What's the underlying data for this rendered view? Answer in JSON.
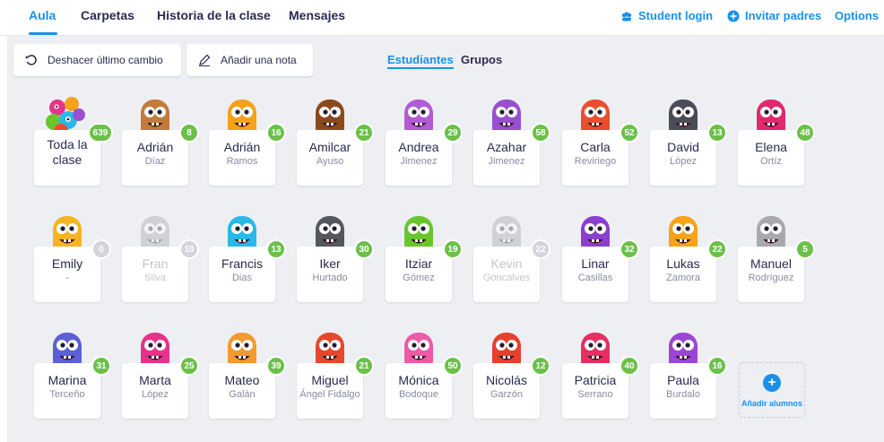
{
  "nav": {
    "tabs": [
      {
        "label": "Aula",
        "active": true
      },
      {
        "label": "Carpetas",
        "active": false
      },
      {
        "label": "Historia de la clase",
        "active": false
      },
      {
        "label": "Mensajes",
        "active": false
      }
    ],
    "student_login": "Student login",
    "invite_parents": "Invitar padres",
    "options": "Options"
  },
  "toolbar": {
    "undo_label": "Deshacer último cambio",
    "note_label": "Añadir una nota",
    "view_students": "Estudiantes",
    "view_groups": "Grupos"
  },
  "whole_class": {
    "label": "Toda la clase",
    "points": "639"
  },
  "students": [
    {
      "first": "Adrián",
      "last": "Díaz",
      "points": "8",
      "color": "#c47a3c",
      "disabled": false
    },
    {
      "first": "Adrián",
      "last": "Ramos",
      "points": "16",
      "color": "#f4a21b",
      "disabled": false
    },
    {
      "first": "Amilcar",
      "last": "Ayuso",
      "points": "21",
      "color": "#8b4a1c",
      "disabled": false
    },
    {
      "first": "Andrea",
      "last": "Jimenez",
      "points": "29",
      "color": "#b35bd6",
      "disabled": false
    },
    {
      "first": "Azahar",
      "last": "Jimenez",
      "points": "58",
      "color": "#9a4fd1",
      "disabled": false
    },
    {
      "first": "Carla",
      "last": "Reviriego",
      "points": "52",
      "color": "#ea4e2e",
      "disabled": false
    },
    {
      "first": "David",
      "last": "López",
      "points": "13",
      "color": "#4a4d57",
      "disabled": false
    },
    {
      "first": "Elena",
      "last": "Ortíz",
      "points": "48",
      "color": "#e0286f",
      "disabled": false
    },
    {
      "first": "Emily",
      "last": "-",
      "points": "0",
      "color": "#f6b324",
      "disabled": false
    },
    {
      "first": "Fran",
      "last": "Silva",
      "points": "10",
      "color": "#9a9aa5",
      "disabled": true
    },
    {
      "first": "Francis",
      "last": "Dias",
      "points": "13",
      "color": "#2ab8e8",
      "disabled": false
    },
    {
      "first": "Iker",
      "last": "Hurtado",
      "points": "30",
      "color": "#55575f",
      "disabled": false
    },
    {
      "first": "Itziar",
      "last": "Gómez",
      "points": "19",
      "color": "#68c62d",
      "disabled": false
    },
    {
      "first": "Kevin",
      "last": "Goncalves",
      "points": "22",
      "color": "#9a9aa5",
      "disabled": true
    },
    {
      "first": "Linar",
      "last": "Casillas",
      "points": "32",
      "color": "#8b3fcf",
      "disabled": false
    },
    {
      "first": "Lukas",
      "last": "Zamora",
      "points": "22",
      "color": "#f7a318",
      "disabled": false
    },
    {
      "first": "Manuel",
      "last": "Rodríguez",
      "points": "5",
      "color": "#a8a8ad",
      "disabled": false
    },
    {
      "first": "Marina",
      "last": "Terceño",
      "points": "31",
      "color": "#5c5fd6",
      "disabled": false
    },
    {
      "first": "Marta",
      "last": "López",
      "points": "25",
      "color": "#e8328a",
      "disabled": false
    },
    {
      "first": "Mateo",
      "last": "Galán",
      "points": "39",
      "color": "#f29a2e",
      "disabled": false
    },
    {
      "first": "Miguel",
      "last": "Ángel Fidalgo",
      "points": "21",
      "color": "#e6482b",
      "disabled": false
    },
    {
      "first": "Mónica",
      "last": "Bodoque",
      "points": "50",
      "color": "#ee5aa6",
      "disabled": false
    },
    {
      "first": "Nicolás",
      "last": "Garzón",
      "points": "12",
      "color": "#e6402c",
      "disabled": false
    },
    {
      "first": "Patricia",
      "last": "Serrano",
      "points": "40",
      "color": "#e62e62",
      "disabled": false
    },
    {
      "first": "Paula",
      "last": "Burdalo",
      "points": "16",
      "color": "#9b45d6",
      "disabled": false
    }
  ],
  "add_students": {
    "label": "Añadir alumnos",
    "icon": "plus-icon"
  },
  "colors": {
    "accent": "#1a91e8",
    "badge": "#6cc04a",
    "badge_zero": "#d3d4dc",
    "canvas": "#eeeff3"
  }
}
